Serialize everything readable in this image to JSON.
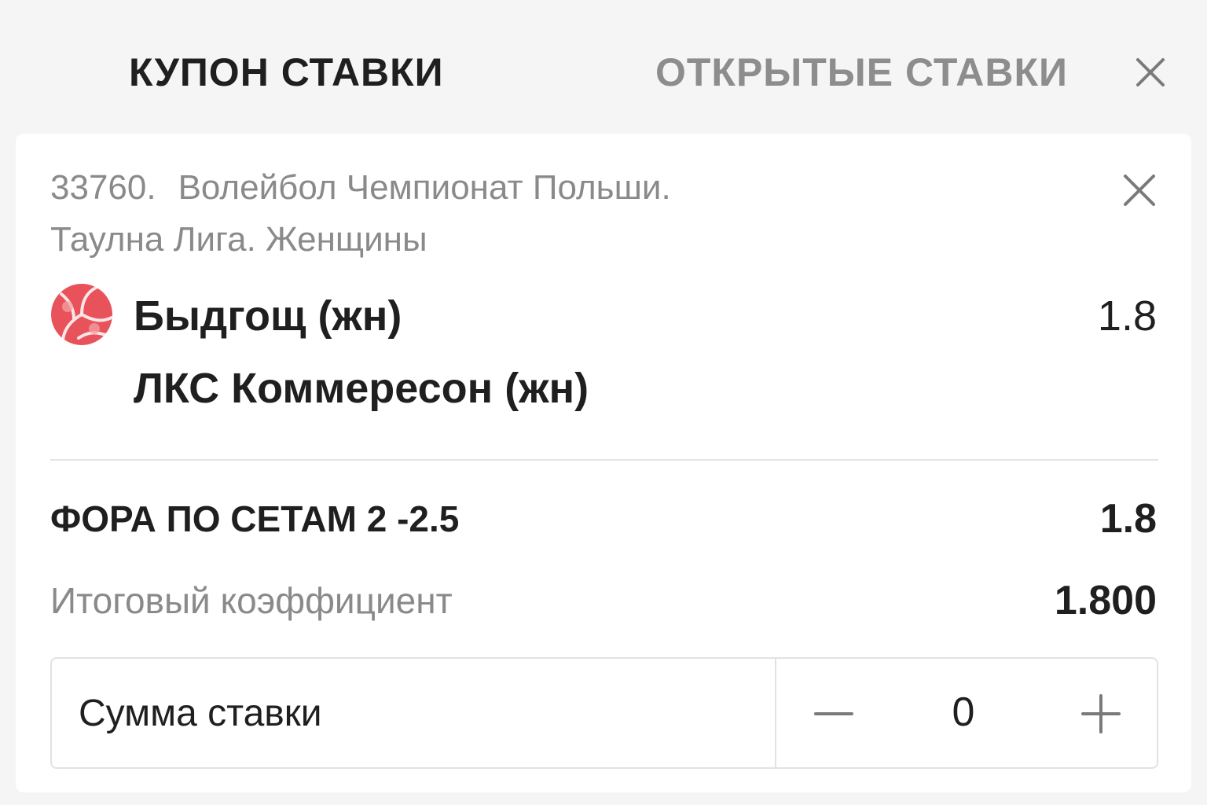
{
  "tabs": {
    "coupon": "КУПОН СТАВКИ",
    "open_bets": "ОТКРЫТЫЕ СТАВКИ"
  },
  "icons": {
    "close": "close-icon",
    "sport": "volleyball-icon",
    "minus": "minus-icon",
    "plus": "plus-icon"
  },
  "colors": {
    "volleyball": "#e8525a"
  },
  "event": {
    "number": "33760.",
    "title_line1": "Волейбол Чемпионат Польши.",
    "title_line2": "Таулна Лига. Женщины",
    "team_1": "Быдгощ (жн)",
    "team_2": "ЛКС Коммересон (жн)",
    "odds": "1.8"
  },
  "bet": {
    "market": "ФОРА ПО СЕТАМ 2 -2.5",
    "market_odds": "1.8",
    "total_label": "Итоговый коэффициент",
    "total_value": "1.800"
  },
  "stake": {
    "label": "Сумма ставки",
    "value": "0"
  }
}
